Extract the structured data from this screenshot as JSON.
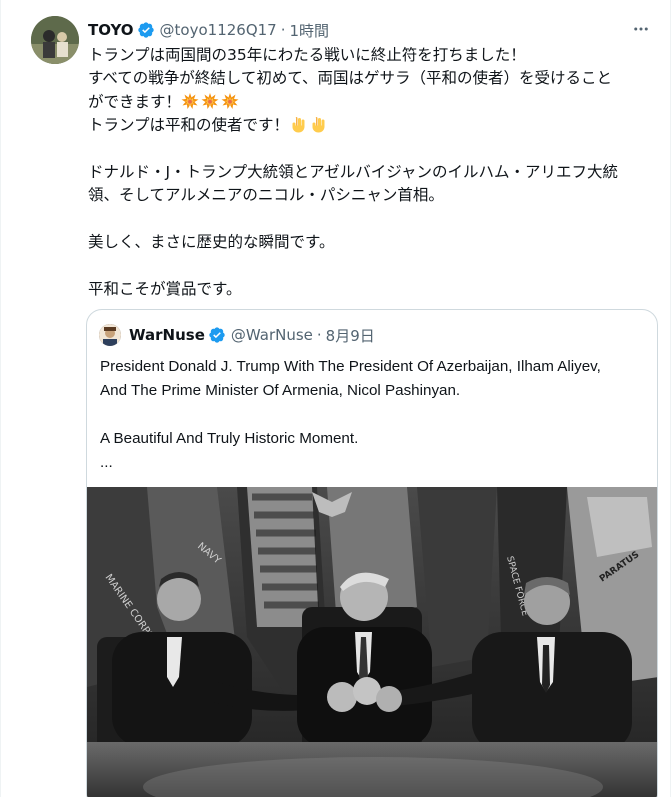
{
  "tweet": {
    "author_name": "TOYO",
    "author_handle": "@toyo1126Q17",
    "separator": "·",
    "time": "1時間",
    "more_label": "···",
    "lines": [
      "トランプは両国間の35年にわたる戦いに終止符を打ちました！",
      "すべての戦争が終結して初めて、両国はゲサラ（平和の使者）を受けること",
      "ができます！",
      "トランプは平和の使者です！",
      "",
      "ドナルド・J・トランプ大統領とアゼルバイジャンのイルハム・アリエフ大統",
      "領、そしてアルメニアのニコル・パシニャン首相。",
      "",
      "美しく、まさに歴史的な瞬間です。",
      "",
      "平和こそが賞品です。"
    ],
    "emoji_line2": [
      "collision-emoji",
      "collision-emoji",
      "collision-emoji"
    ],
    "emoji_line3": [
      "backhand-index-pointing-down-emoji",
      "backhand-index-pointing-down-emoji"
    ]
  },
  "quote": {
    "author_name": "WarNuse",
    "author_handle": "@WarNuse",
    "separator": "·",
    "time": "8月9日",
    "lines": [
      "President Donald J. Trump With The President Of Azerbaijan, Ilham Aliyev,",
      "And The Prime Minister Of Armenia, Nicol Pashinyan.",
      "",
      "A Beautiful And Truly Historic Moment.",
      "..."
    ]
  },
  "flag_texts": [
    "MARINE CORPS",
    "NAVY",
    "SPACE FORCE",
    "PARATUS"
  ],
  "colors": {
    "verified": "#1d9bf0",
    "secondary_text": "#536471",
    "border": "#cfd9de"
  }
}
